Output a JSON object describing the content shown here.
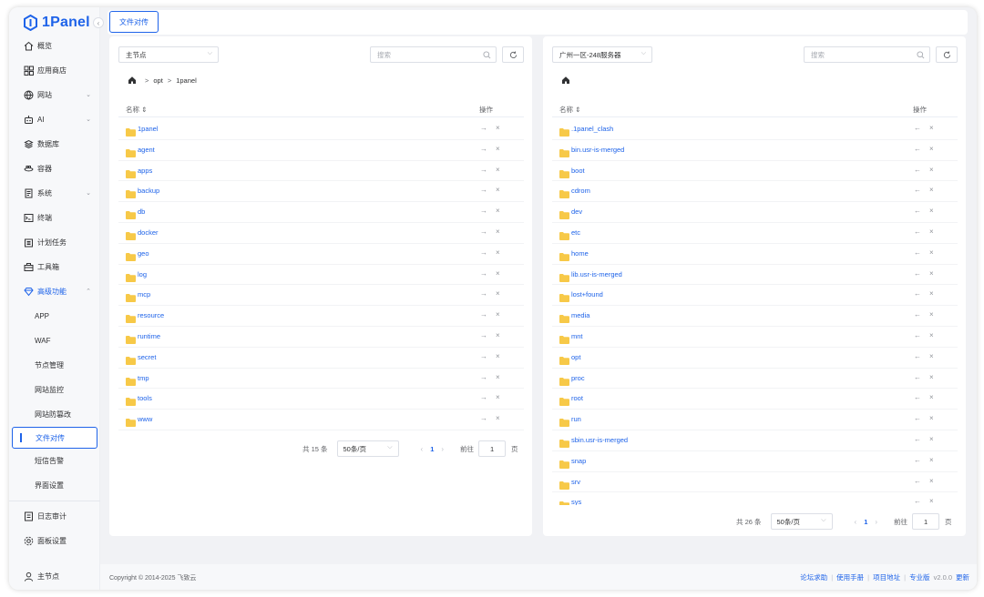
{
  "app": {
    "name": "1Panel"
  },
  "sidebar": {
    "items": [
      {
        "label": "概览",
        "icon": "home-icon"
      },
      {
        "label": "应用商店",
        "icon": "grid-icon"
      },
      {
        "label": "网站",
        "icon": "globe-icon",
        "expandable": true
      },
      {
        "label": "AI",
        "icon": "robot-icon",
        "expandable": true
      },
      {
        "label": "数据库",
        "icon": "database-icon"
      },
      {
        "label": "容器",
        "icon": "container-icon"
      },
      {
        "label": "系统",
        "icon": "system-icon",
        "expandable": true
      },
      {
        "label": "终端",
        "icon": "terminal-icon"
      },
      {
        "label": "计划任务",
        "icon": "calendar-icon"
      },
      {
        "label": "工具箱",
        "icon": "toolbox-icon"
      },
      {
        "label": "高级功能",
        "icon": "diamond-icon",
        "expanded": true
      }
    ],
    "sub_items": [
      "APP",
      "WAF",
      "节点管理",
      "网站监控",
      "网站防篡改",
      "文件对传",
      "短信告警",
      "界面设置"
    ],
    "active_sub": "文件对传",
    "bottom_items": [
      {
        "label": "日志审计",
        "icon": "log-icon"
      },
      {
        "label": "面板设置",
        "icon": "settings-icon"
      }
    ],
    "node_label": "主节点"
  },
  "topbar": {
    "tab_label": "文件对传"
  },
  "left_panel": {
    "node_select": "主节点",
    "search_placeholder": "搜索",
    "breadcrumb": [
      "opt",
      "1panel"
    ],
    "col_name": "名称",
    "col_ops": "操作",
    "files": [
      "1panel",
      "agent",
      "apps",
      "backup",
      "db",
      "docker",
      "geo",
      "log",
      "mcp",
      "resource",
      "runtime",
      "secret",
      "tmp",
      "tools",
      "www"
    ],
    "op_transfer": "→",
    "op_delete": "×",
    "pager": {
      "total": "共 15 条",
      "page_size": "50条/页",
      "current": "1",
      "goto_label": "前往",
      "goto_value": "1",
      "unit": "页",
      "prev": "‹",
      "next": "›"
    }
  },
  "right_panel": {
    "node_select": "广州一区-248服务器",
    "search_placeholder": "搜索",
    "col_name": "名称",
    "col_ops": "操作",
    "files": [
      ".1panel_clash",
      "bin.usr-is-merged",
      "boot",
      "cdrom",
      "dev",
      "etc",
      "home",
      "lib.usr-is-merged",
      "lost+found",
      "media",
      "mnt",
      "opt",
      "proc",
      "root",
      "run",
      "sbin.usr-is-merged",
      "snap",
      "srv",
      "sys"
    ],
    "op_transfer": "←",
    "op_delete": "×",
    "pager": {
      "total": "共 26 条",
      "page_size": "50条/页",
      "current": "1",
      "goto_label": "前往",
      "goto_value": "1",
      "unit": "页",
      "prev": "‹",
      "next": "›"
    }
  },
  "footer": {
    "copyright": "Copyright © 2014-2025 飞致云",
    "links": [
      "论坛求助",
      "使用手册",
      "项目地址",
      "专业版"
    ],
    "version": "v2.0.0",
    "update": "更新"
  },
  "colors": {
    "accent": "#1e63e9",
    "folder": "#f7c948",
    "background": "#f1f2f5"
  }
}
